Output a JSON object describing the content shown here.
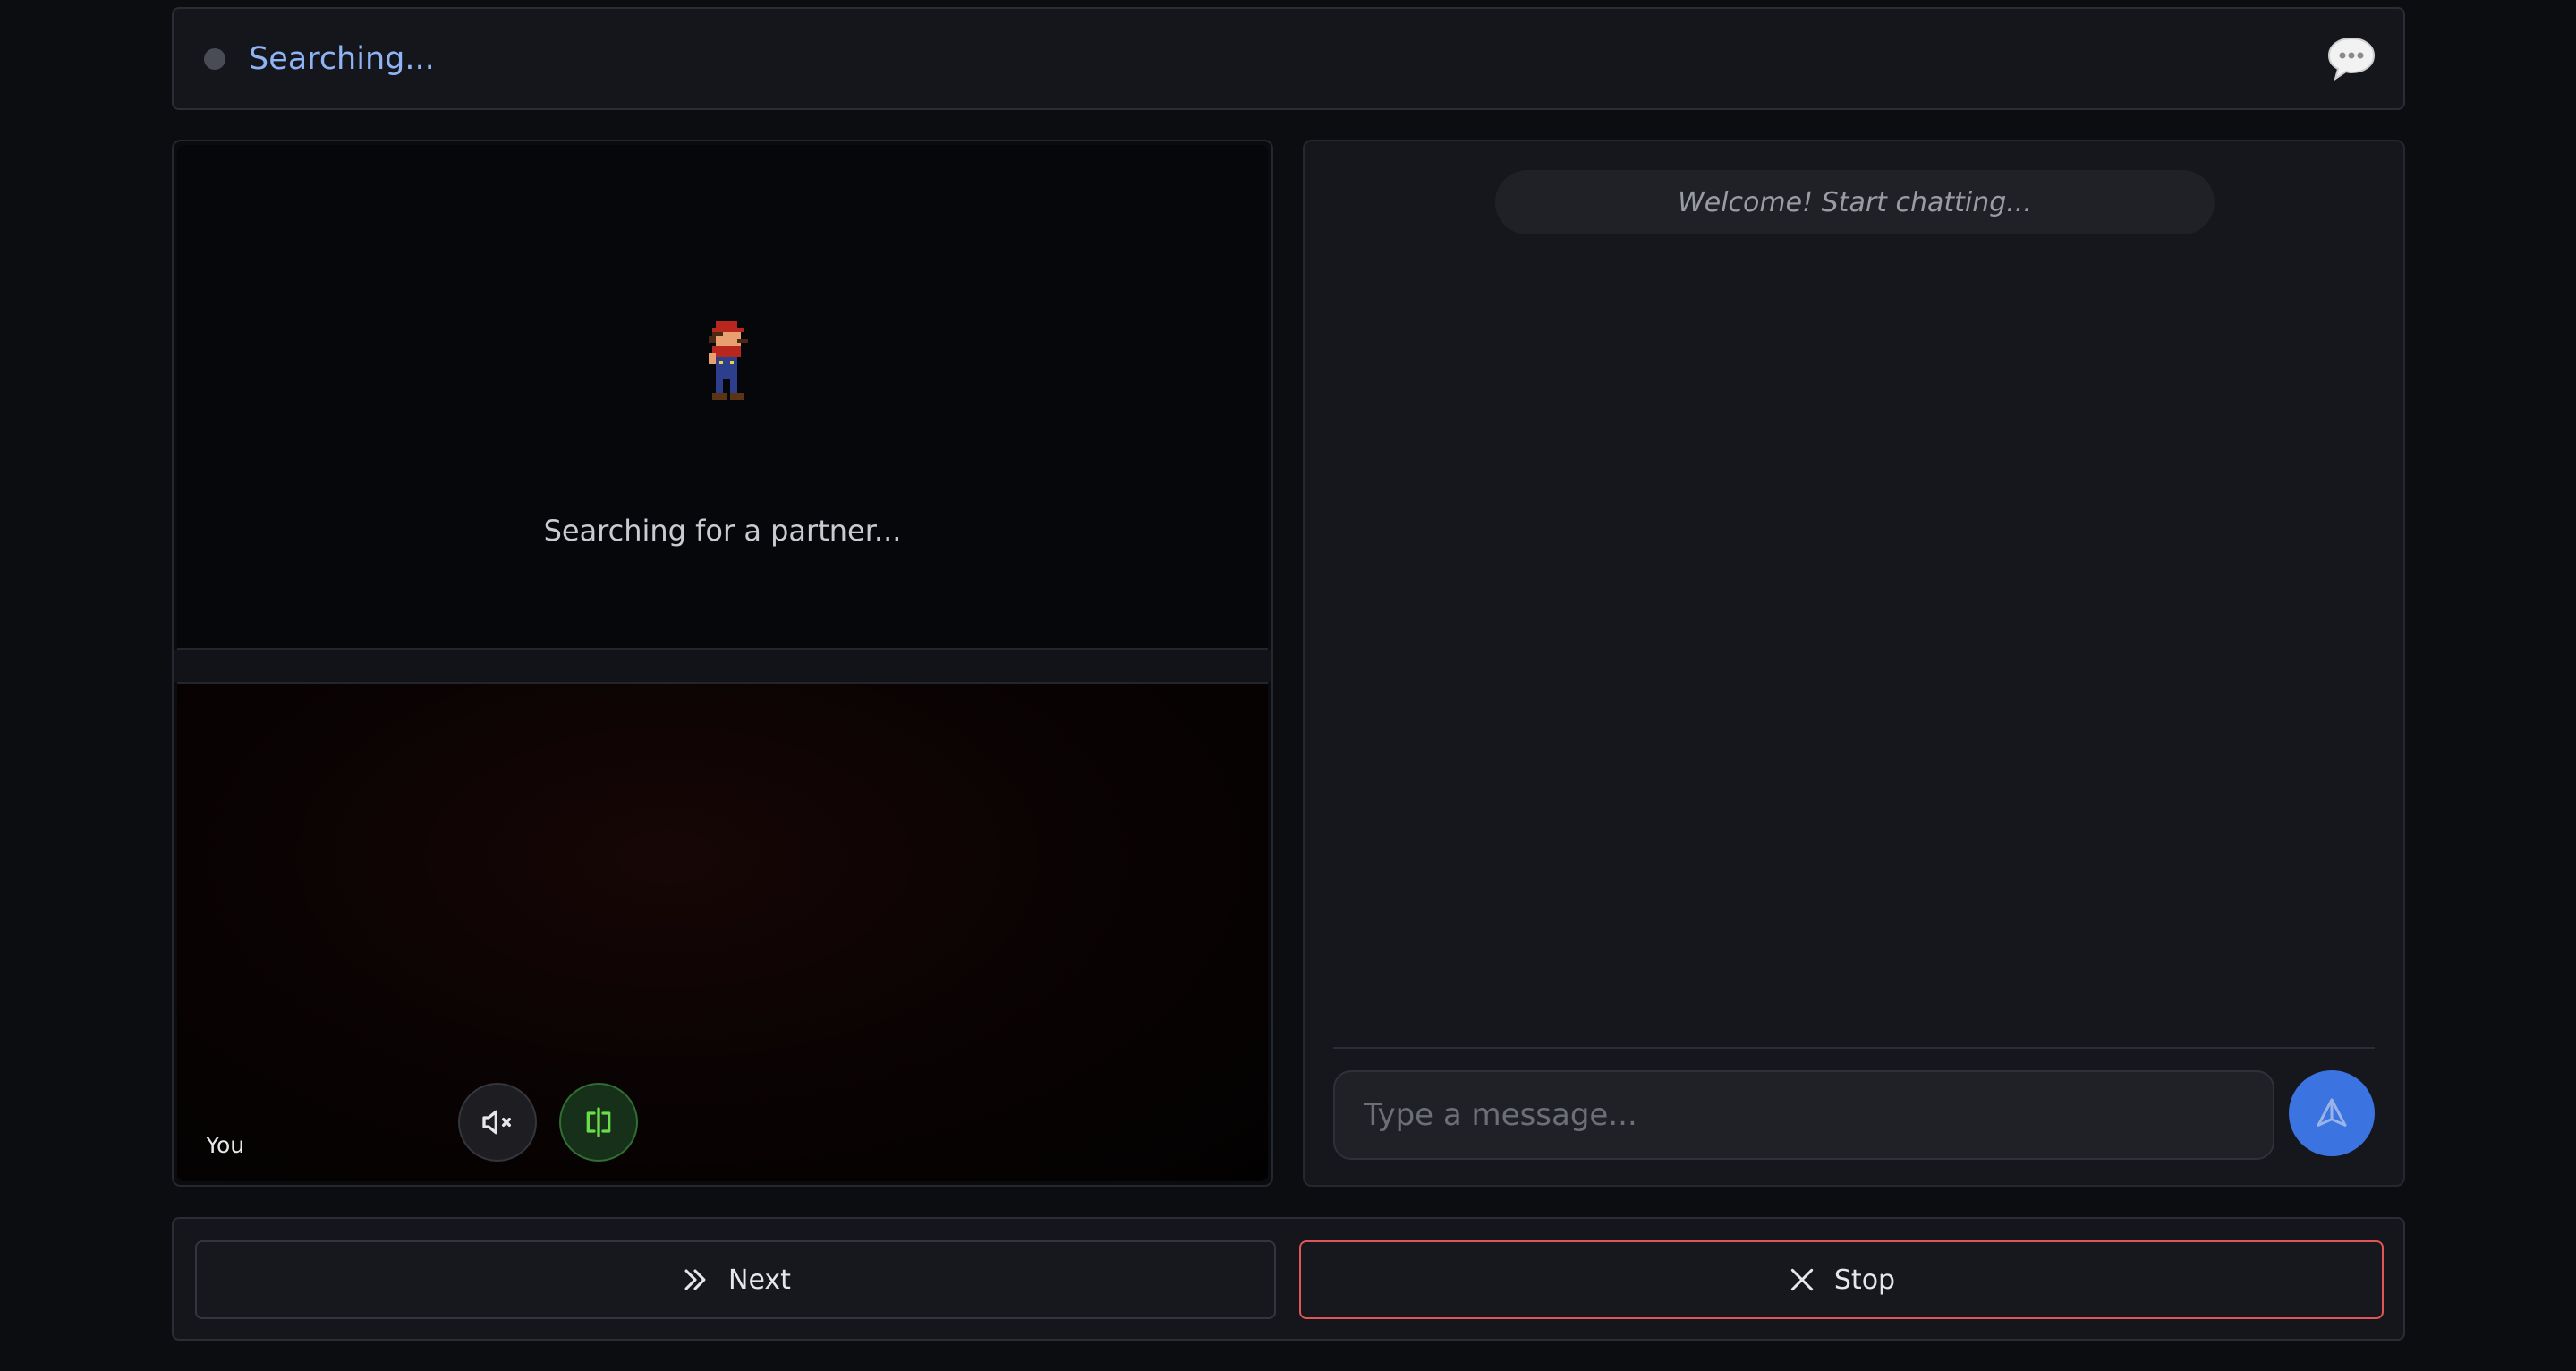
{
  "status": {
    "text": "Searching...",
    "dot_color": "#4a4c55",
    "chat_toggle_icon": "speech-bubble-icon"
  },
  "remote": {
    "searching_text": "Searching for a partner...",
    "avatar_icon": "mario-sprite-icon"
  },
  "local": {
    "label": "You",
    "mute_icon": "speaker-muted-icon",
    "mirror_icon": "mirror-flip-icon"
  },
  "chat": {
    "welcome": "Welcome! Start chatting...",
    "input_placeholder": "Type a message...",
    "send_icon": "send-icon",
    "accent": "#3b73e0"
  },
  "actions": {
    "next_label": "Next",
    "next_icon": "double-chevron-right-icon",
    "stop_label": "Stop",
    "stop_icon": "close-icon",
    "stop_color": "#e05555"
  }
}
